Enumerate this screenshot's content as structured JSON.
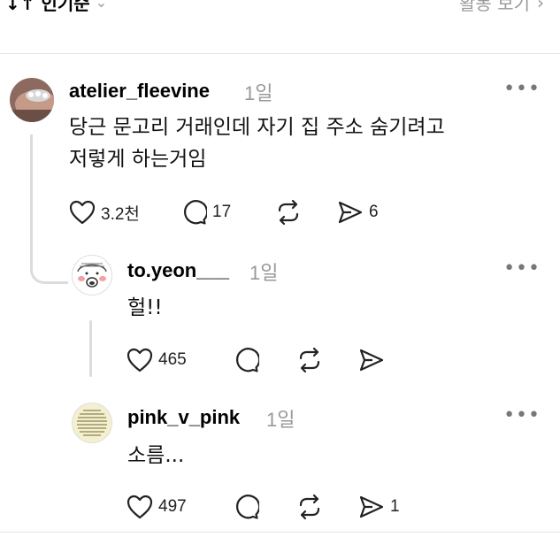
{
  "header": {
    "sort_label": "↓↑ 인기순",
    "activity_label": "활동 보기"
  },
  "comments": [
    {
      "username": "atelier_fleevine",
      "time": "1일",
      "text_line1": "당근 문고리 거래인데 자기 집 주소 숨기려고",
      "text_line2": "저렇게 하는거임",
      "likes": "3.2천",
      "replies": "17",
      "reposts": "",
      "shares": "6"
    },
    {
      "username": "to.yeon___",
      "time": "1일",
      "text": "헐!!",
      "likes": "465",
      "replies": "",
      "reposts": "",
      "shares": ""
    },
    {
      "username": "pink_v_pink",
      "time": "1일",
      "text": "소름...",
      "likes": "497",
      "replies": "",
      "reposts": "",
      "shares": "1"
    }
  ],
  "more_glyph": "•••",
  "colors": {
    "muted": "#999999",
    "thread": "#dcdcdc"
  }
}
